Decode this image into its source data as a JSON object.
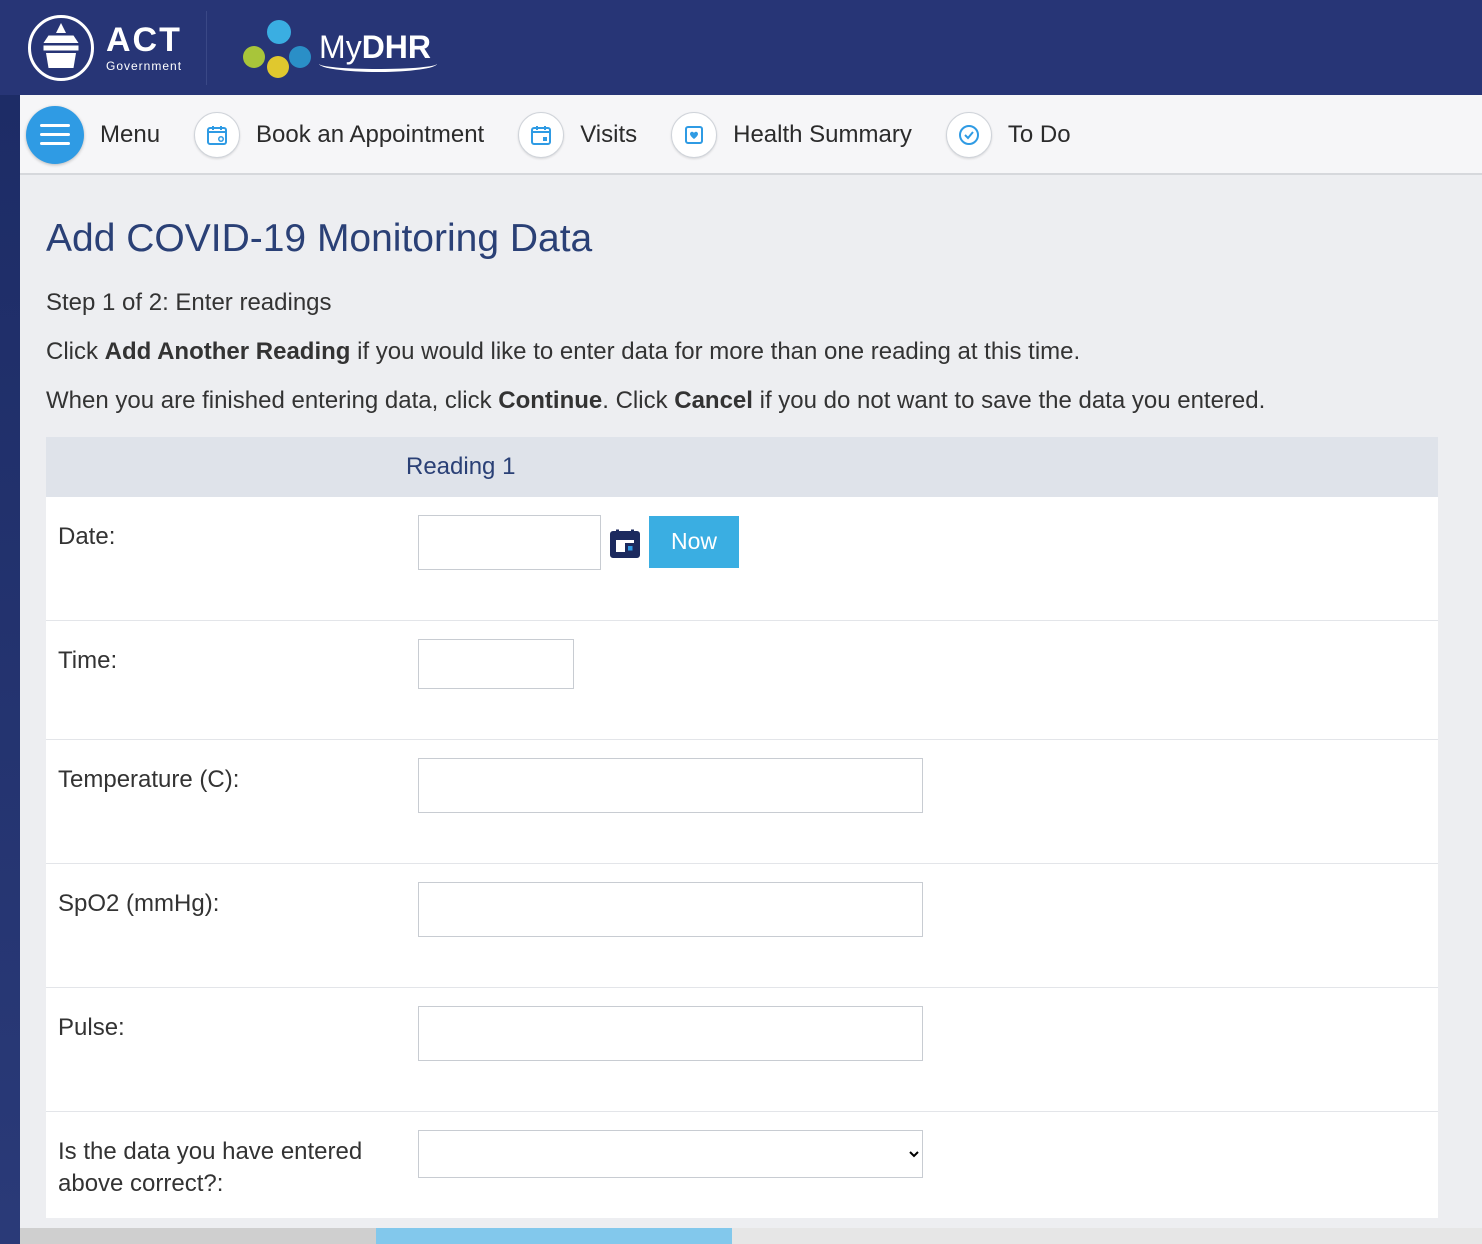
{
  "header": {
    "act_label": "ACT",
    "act_sub": "Government",
    "mydhr_prefix": "My",
    "mydhr_bold": "DHR"
  },
  "toolbar": {
    "menu": "Menu",
    "book": "Book an Appointment",
    "visits": "Visits",
    "health": "Health Summary",
    "todo": "To Do"
  },
  "page": {
    "title": "Add COVID-19 Monitoring Data",
    "step": "Step 1 of 2: Enter readings",
    "instr1_pre": "Click ",
    "instr1_bold": "Add Another Reading",
    "instr1_post": " if you would like to enter data for more than one reading at this time.",
    "instr2_pre": "When you are finished entering data, click ",
    "instr2_b1": "Continue",
    "instr2_mid": ". Click ",
    "instr2_b2": "Cancel",
    "instr2_post": " if you do not want to save the data you entered."
  },
  "table": {
    "reading_header": "Reading 1",
    "rows": {
      "date": "Date:",
      "time": "Time:",
      "temp": "Temperature (C):",
      "spo2": "SpO2 (mmHg):",
      "pulse": "Pulse:",
      "confirm": "Is the data you have entered above correct?:"
    },
    "now_button": "Now",
    "values": {
      "date": "",
      "time": "",
      "temp": "",
      "spo2": "",
      "pulse": "",
      "confirm": ""
    }
  }
}
